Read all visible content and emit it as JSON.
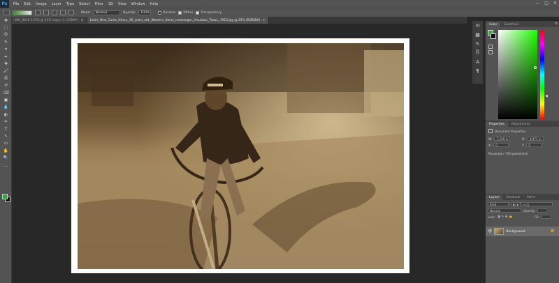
{
  "app": {
    "logo": "Ps"
  },
  "menu": [
    "File",
    "Edit",
    "Image",
    "Layer",
    "Type",
    "Select",
    "Filter",
    "3D",
    "View",
    "Window",
    "Help"
  ],
  "window_controls": [
    "—",
    "□",
    "✕"
  ],
  "options": {
    "mode_label": "Mode:",
    "mode_value": "Normal",
    "opacity_label": "Opacity:",
    "opacity_value": "100%",
    "reverse_label": "Reverse",
    "dither_label": "Dither",
    "transparency_label": "Transparency",
    "reverse_checked": false,
    "dither_checked": true,
    "transparency_checked": true
  },
  "tabs": [
    {
      "label": "IMG_0016-2.CR2 @ 25% (Layer 1, RGB/8*)",
      "active": false
    },
    {
      "label": "Lewis_Hine_Curtis_Hines,_16_years_old,_Western_Union_messenger,_Houston,_Texas,_1913.jpg @ 25% (RGB/8#)",
      "active": true
    }
  ],
  "tools": [
    "move-icon",
    "marquee-icon",
    "lasso-icon",
    "quick-select-icon",
    "crop-icon",
    "eyedropper-icon",
    "healing-icon",
    "brush-icon",
    "clone-stamp-icon",
    "history-brush-icon",
    "eraser-icon",
    "gradient-icon",
    "blur-icon",
    "dodge-icon",
    "pen-icon",
    "type-icon",
    "path-select-icon",
    "rectangle-icon",
    "hand-icon",
    "zoom-icon",
    "more-tools-icon"
  ],
  "tool_glyphs": [
    "✥",
    "⬚",
    "ʘ",
    "✎",
    "⌗",
    "✒",
    "✚",
    "🖌",
    "⎙",
    "↺",
    "⌫",
    "▣",
    "💧",
    "◐",
    "✒",
    "T",
    "↖",
    "▭",
    "✋",
    "🔍",
    "…"
  ],
  "colors": {
    "foreground": "#2ea83a",
    "background": "#111111"
  },
  "color_panel": {
    "tabs": [
      "Color",
      "Swatches"
    ],
    "active": "Color"
  },
  "properties_panel": {
    "tabs": [
      "Properties",
      "Adjustments"
    ],
    "active": "Properties",
    "title": "Document Properties",
    "w_label": "W:",
    "w_value": "7,240 in",
    "h_label": "H:",
    "h_value": "4,971 in",
    "x_label": "X:",
    "x_value": "0",
    "y_label": "Y:",
    "y_value": "0",
    "resolution": "Resolution: 700 pixels/inch"
  },
  "layers_panel": {
    "tabs": [
      "Layers",
      "Channels",
      "Paths"
    ],
    "active": "Layers",
    "kind_label": "Kind",
    "blend_value": "Normal",
    "opacity_label": "Opacity:",
    "lock_label": "Lock:",
    "fill_label": "Fill:",
    "layer_name": "Background"
  }
}
